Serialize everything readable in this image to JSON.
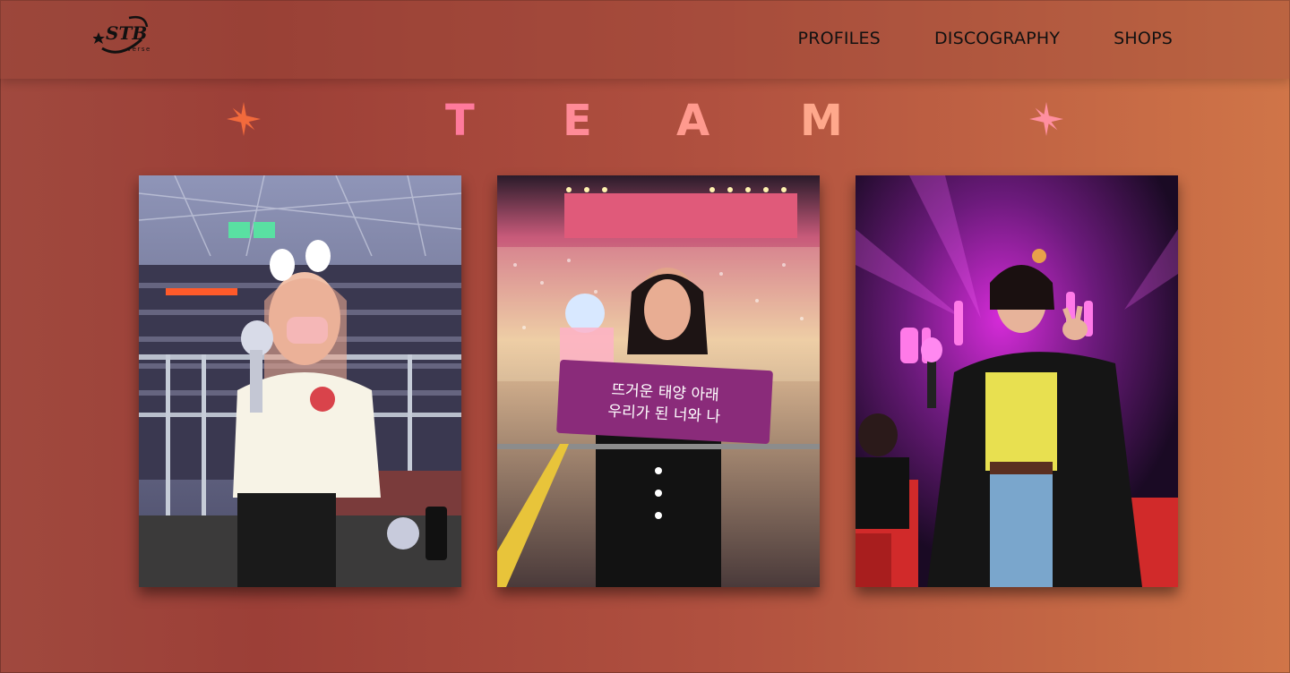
{
  "brand": {
    "logo_text": "STB",
    "logo_subtext": "verse",
    "logo_icon": "star-swoosh-logo"
  },
  "nav": {
    "items": [
      {
        "label": "PROFILES"
      },
      {
        "label": "DISCOGRAPHY"
      },
      {
        "label": "SHOPS"
      }
    ]
  },
  "team": {
    "letters": [
      "T",
      "E",
      "A",
      "M"
    ],
    "star_icon": "asterisk-star-icon",
    "colors": {
      "star_left": "#f26a3c",
      "star_right": "#ff8fa0"
    }
  },
  "photos": [
    {
      "name": "team-photo-1",
      "subject": "fan-with-lightstick-arena"
    },
    {
      "name": "team-photo-2",
      "subject": "fan-with-banner-concert",
      "banner_line1": "뜨거운 태양 아래",
      "banner_line2": "우리가 된 너와 나"
    },
    {
      "name": "team-photo-3",
      "subject": "fan-peace-sign-purple-stage"
    }
  ],
  "colors": {
    "bg_start": "#9c3f37",
    "bg_end": "#d07548",
    "nav_text": "#111111"
  }
}
